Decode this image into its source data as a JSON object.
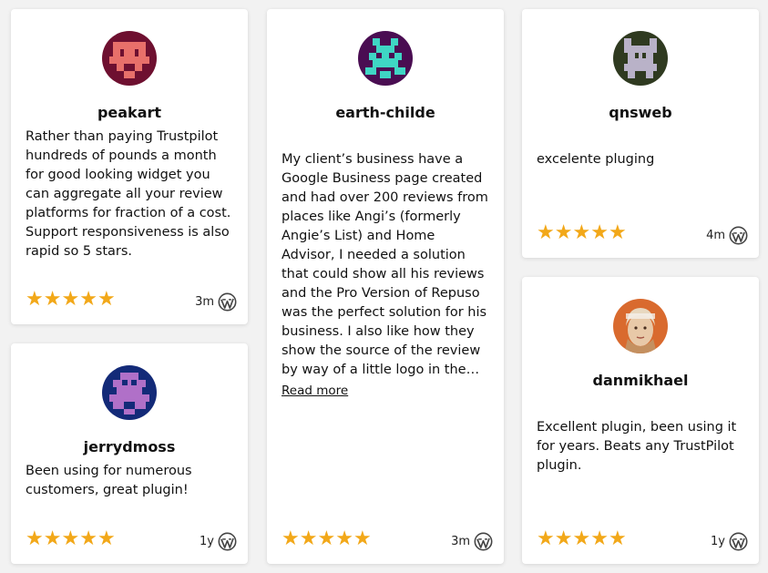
{
  "reviews": [
    {
      "name": "peakart",
      "text": "Rather than paying Trustpilot hundreds of pounds a month for good looking widget you can aggregate all your review platforms for fraction of a cost. Support responsiveness is also rapid so 5 stars.",
      "rating": 5,
      "time": "3m",
      "source_icon": "wordpress-icon",
      "avatar_colors": {
        "bg": "#6e1030",
        "fg": "#e8706a"
      }
    },
    {
      "name": "earth-childe",
      "text": "My client’s business have a Google Business page created and had over 200 reviews from places like Angi’s (formerly Angie’s List) and Home Advisor, I needed a solution that could show all his reviews and the Pro Version of Repuso was the perfect solution for his business. I also like how they show the source of the review by way of a little logo in the…",
      "read_more": "Read more",
      "rating": 5,
      "time": "3m",
      "source_icon": "wordpress-icon",
      "avatar_colors": {
        "bg": "#4a0d52",
        "fg": "#3fd6c4"
      }
    },
    {
      "name": "qnsweb",
      "text": "excelente pluging",
      "rating": 5,
      "time": "4m",
      "source_icon": "wordpress-icon",
      "avatar_colors": {
        "bg": "#2f3a20",
        "fg": "#b9b2c8"
      }
    },
    {
      "name": "jerrydmoss",
      "text": "Been using for numerous customers, great plugin!",
      "rating": 5,
      "time": "1y",
      "source_icon": "wordpress-icon",
      "avatar_colors": {
        "bg": "#132a78",
        "fg": "#b070c8"
      }
    },
    {
      "name": "danmikhael",
      "text": "Excellent plugin, been using it for years. Beats any TrustPilot plugin.",
      "rating": 5,
      "time": "1y",
      "source_icon": "wordpress-icon",
      "avatar_colors": {
        "bg": "#d96a2e",
        "fg": "#e8d8c0"
      }
    }
  ],
  "star_color": "#f2a819",
  "star_glyph": "★"
}
